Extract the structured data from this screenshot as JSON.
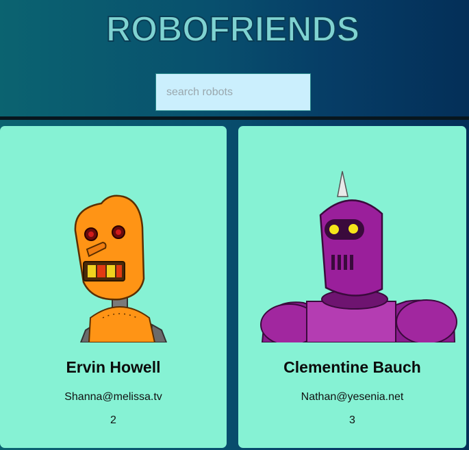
{
  "app": {
    "title": "ROBOFRIENDS"
  },
  "search": {
    "placeholder": "search robots",
    "value": ""
  },
  "robots": [
    {
      "name": "Ervin Howell",
      "email": "Shanna@melissa.tv",
      "id": "2",
      "icon": "robot-orange-icon"
    },
    {
      "name": "Clementine Bauch",
      "email": "Nathan@yesenia.net",
      "id": "3",
      "icon": "robot-purple-icon"
    }
  ],
  "colors": {
    "card_bg": "#86f2d4",
    "title_fill": "#7fd3d1",
    "search_bg": "#cbeffd",
    "divider": "#07161e"
  }
}
